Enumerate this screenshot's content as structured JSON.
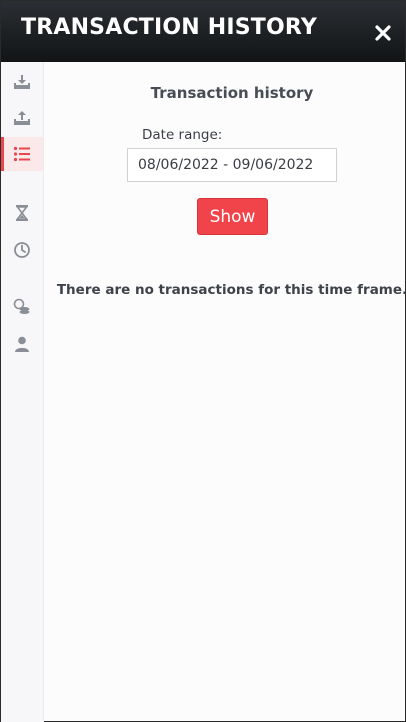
{
  "header": {
    "title": "TRANSACTION HISTORY",
    "close_icon": "close-icon"
  },
  "sidebar": {
    "items": [
      {
        "icon": "deposit-icon",
        "active": false
      },
      {
        "icon": "withdraw-icon",
        "active": false
      },
      {
        "icon": "transaction-list-icon",
        "active": true
      },
      {
        "icon": "hourglass-icon",
        "active": false
      },
      {
        "icon": "clock-icon",
        "active": false
      },
      {
        "icon": "coins-icon",
        "active": false
      },
      {
        "icon": "user-icon",
        "active": false
      }
    ]
  },
  "main": {
    "title": "Transaction history",
    "date_range": {
      "label": "Date range:",
      "value": "08/06/2022 - 09/06/2022"
    },
    "show_label": "Show",
    "empty_message": "There are no transactions for this time frame."
  },
  "colors": {
    "accent": "#f0434a",
    "header_bg": "#1c1f22",
    "active_nav_bg": "#fbe9ea"
  }
}
